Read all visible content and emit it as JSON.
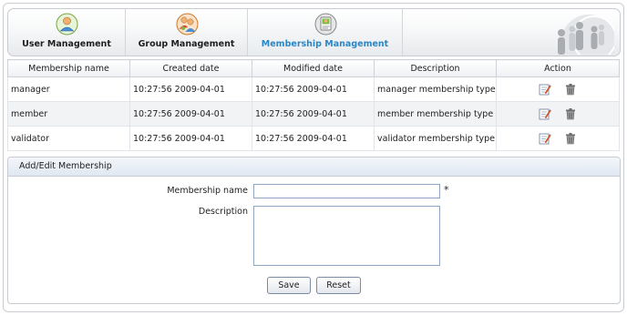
{
  "toolbar": {
    "tabs": [
      {
        "label": "User Management",
        "icon": "user-icon",
        "active": false
      },
      {
        "label": "Group Management",
        "icon": "group-icon",
        "active": false
      },
      {
        "label": "Membership Management",
        "icon": "membership-icon",
        "active": true
      }
    ],
    "active_color": "#2b86c6"
  },
  "table": {
    "columns": [
      "Membership name",
      "Created date",
      "Modified date",
      "Description",
      "Action"
    ],
    "rows": [
      {
        "name": "manager",
        "created": "10:27:56 2009-04-01",
        "modified": "10:27:56 2009-04-01",
        "description": "manager membership type"
      },
      {
        "name": "member",
        "created": "10:27:56 2009-04-01",
        "modified": "10:27:56 2009-04-01",
        "description": "member membership type"
      },
      {
        "name": "validator",
        "created": "10:27:56 2009-04-01",
        "modified": "10:27:56 2009-04-01",
        "description": "validator membership type"
      }
    ],
    "action_icons": [
      "edit-icon",
      "trash-icon"
    ]
  },
  "form": {
    "title": "Add/Edit Membership",
    "name_label": "Membership name",
    "name_value": "",
    "required_mark": "*",
    "description_label": "Description",
    "description_value": "",
    "save_label": "Save",
    "reset_label": "Reset"
  }
}
